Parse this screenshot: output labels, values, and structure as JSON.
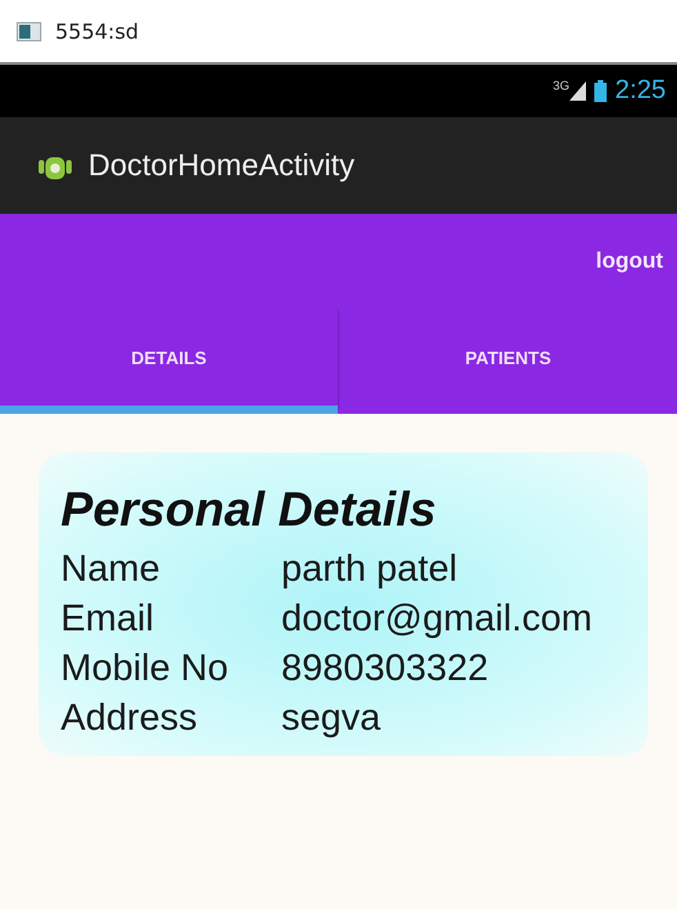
{
  "window": {
    "title": "5554:sd"
  },
  "status_bar": {
    "network": "3G",
    "time": "2:25"
  },
  "action_bar": {
    "title": "DoctorHomeActivity"
  },
  "toolbar": {
    "action": "logout"
  },
  "tabs": [
    {
      "label": "DETAILS",
      "selected": true
    },
    {
      "label": "PATIENTS",
      "selected": false
    }
  ],
  "card": {
    "heading": "Personal Details",
    "fields": [
      {
        "label": "Name",
        "value": "parth patel"
      },
      {
        "label": "Email",
        "value": "doctor@gmail.com"
      },
      {
        "label": "Mobile No",
        "value": "8980303322"
      },
      {
        "label": "Address",
        "value": "segva"
      }
    ]
  }
}
